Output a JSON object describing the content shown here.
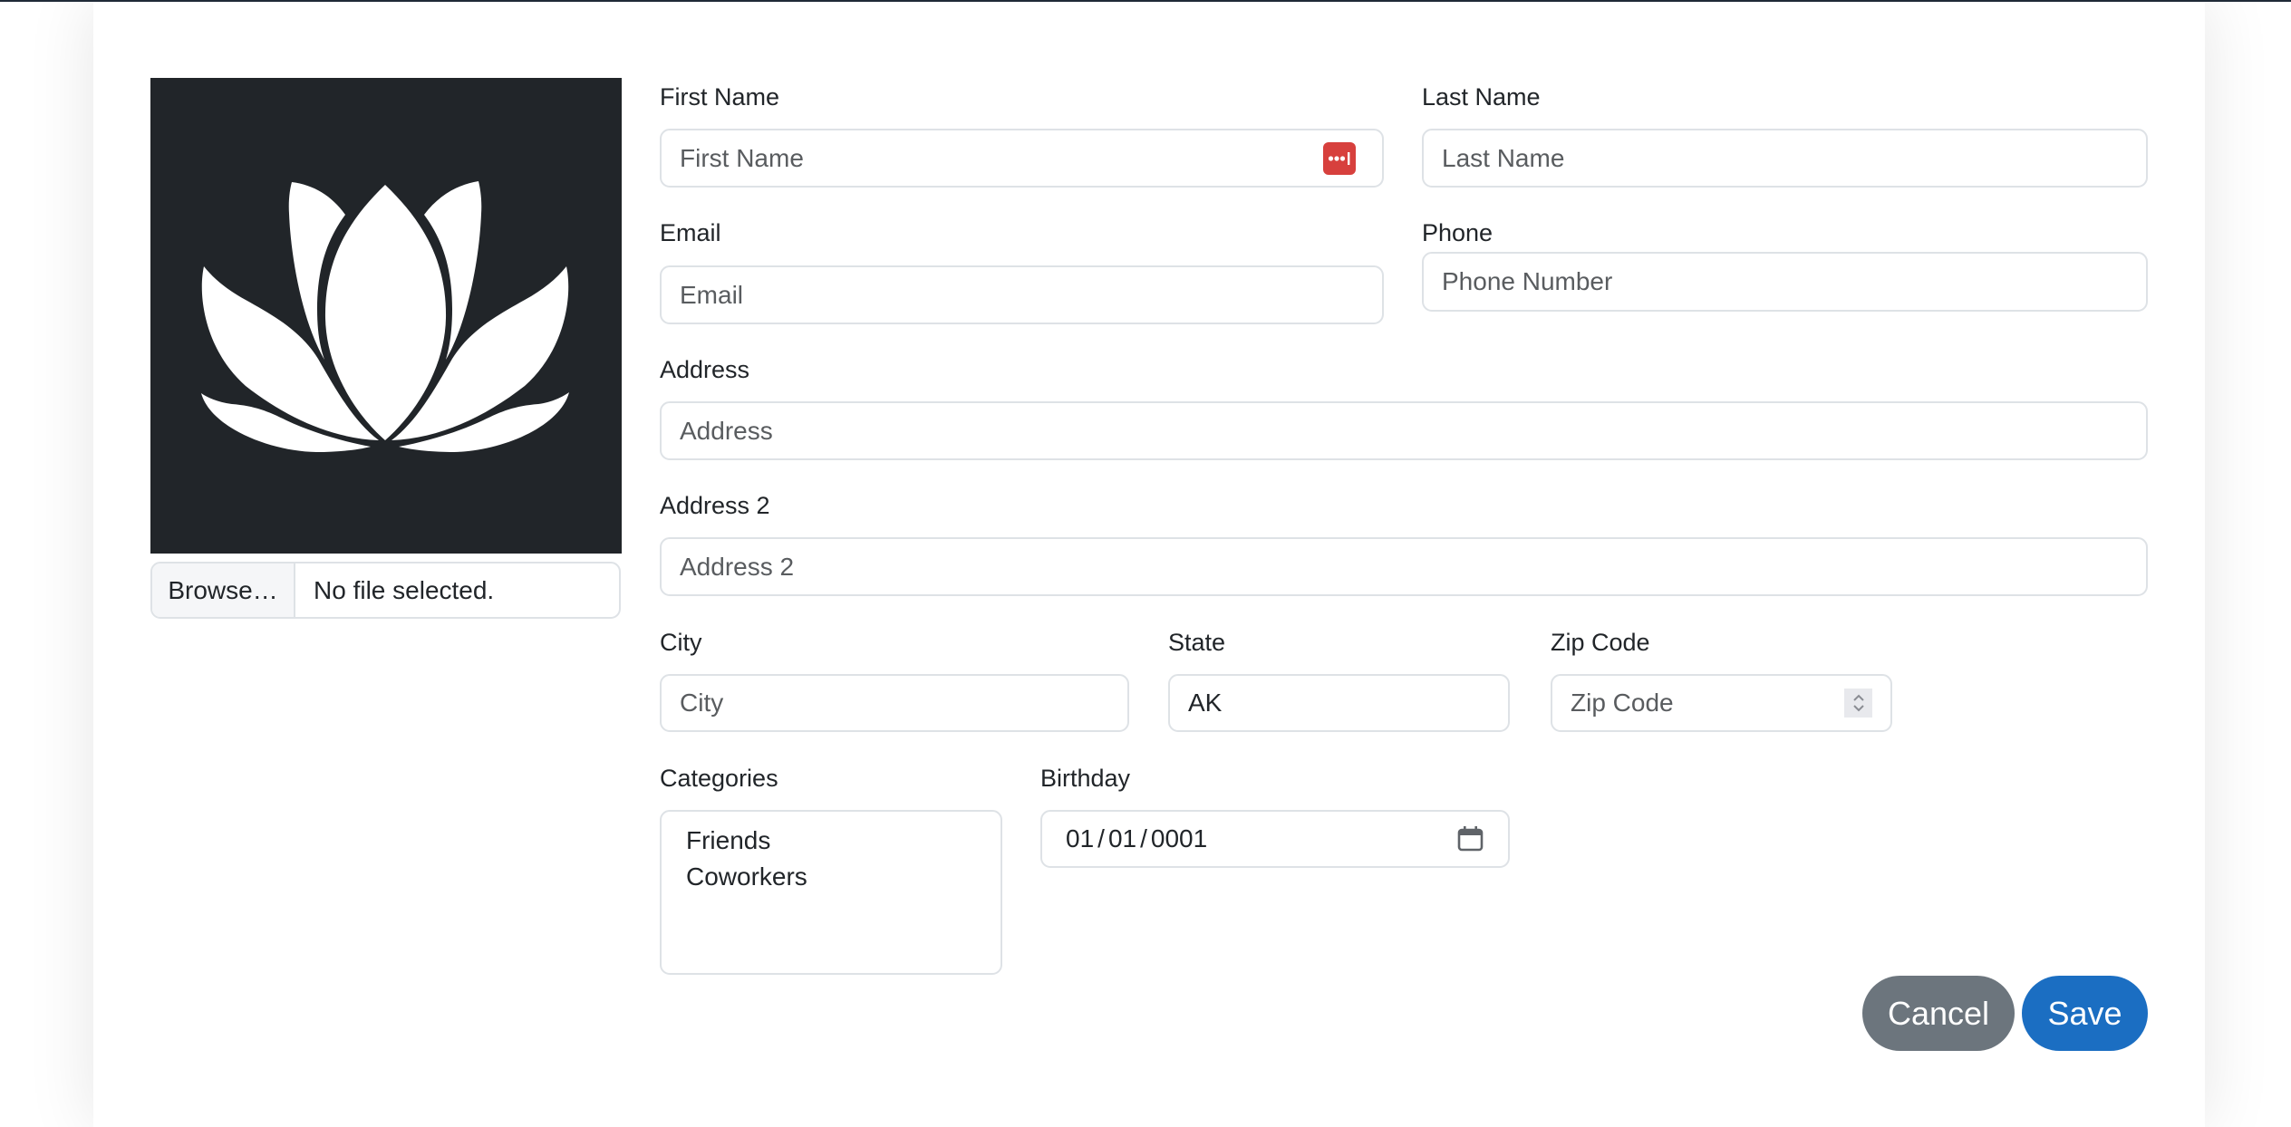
{
  "photo": {
    "alt": "lotus-logo",
    "background_color": "#212529",
    "browse_label": "Browse…",
    "file_status": "No file selected."
  },
  "form": {
    "first_name": {
      "label": "First Name",
      "placeholder": "First Name",
      "value": ""
    },
    "last_name": {
      "label": "Last Name",
      "placeholder": "Last Name",
      "value": ""
    },
    "email": {
      "label": "Email",
      "placeholder": "Email",
      "value": ""
    },
    "phone": {
      "label": "Phone",
      "placeholder": "Phone Number",
      "value": ""
    },
    "address": {
      "label": "Address",
      "placeholder": "Address",
      "value": ""
    },
    "address2": {
      "label": "Address 2",
      "placeholder": "Address 2",
      "value": ""
    },
    "city": {
      "label": "City",
      "placeholder": "City",
      "value": ""
    },
    "state": {
      "label": "State",
      "value": "AK"
    },
    "zip": {
      "label": "Zip Code",
      "placeholder": "Zip Code",
      "value": ""
    },
    "categories": {
      "label": "Categories",
      "options": [
        "Friends",
        "Coworkers"
      ]
    },
    "birthday": {
      "label": "Birthday",
      "month": "01",
      "day": "01",
      "year": "0001",
      "separator": "/"
    }
  },
  "buttons": {
    "cancel": "Cancel",
    "save": "Save"
  },
  "colors": {
    "save": "#1b6ec2",
    "cancel": "#6c757d",
    "password_manager_icon": "#d7403d"
  },
  "icons": {
    "password_manager": "password-manager-icon",
    "calendar": "calendar-icon",
    "spinner": "number-spinner-icon"
  }
}
